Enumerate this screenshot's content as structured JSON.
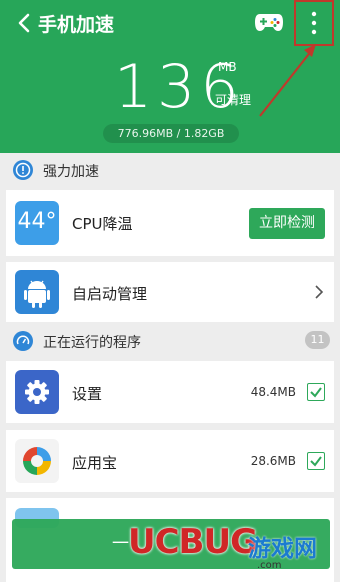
{
  "header": {
    "title": "手机加速",
    "memory_value": "136",
    "memory_unit": "MB",
    "cleanable_label": "可清理",
    "memory_usage": "776.96MB / 1.82GB"
  },
  "icons": {
    "back": "back-arrow-icon",
    "game": "gamepad-icon",
    "menu": "more-vertical-icon"
  },
  "boost_section": {
    "label": "强力加速"
  },
  "cpu_card": {
    "temp": "44°",
    "label": "CPU降温",
    "button": "立即检测"
  },
  "autostart_card": {
    "label": "自启动管理"
  },
  "running_section": {
    "label": "正在运行的程序",
    "count": "11"
  },
  "apps": [
    {
      "name": "设置",
      "size": "48.4MB",
      "checked": true
    },
    {
      "name": "应用宝",
      "size": "28.6MB",
      "checked": true
    }
  ],
  "bottom": {
    "button_label": "一"
  },
  "watermark": {
    "logo": "UCBUG",
    "site_cn": "游戏网",
    "url": ".com"
  },
  "colors": {
    "header_green": "#27a659",
    "button_green": "#2ea85a",
    "info_blue": "#2f86d6",
    "highlight_red": "#c0392b"
  }
}
